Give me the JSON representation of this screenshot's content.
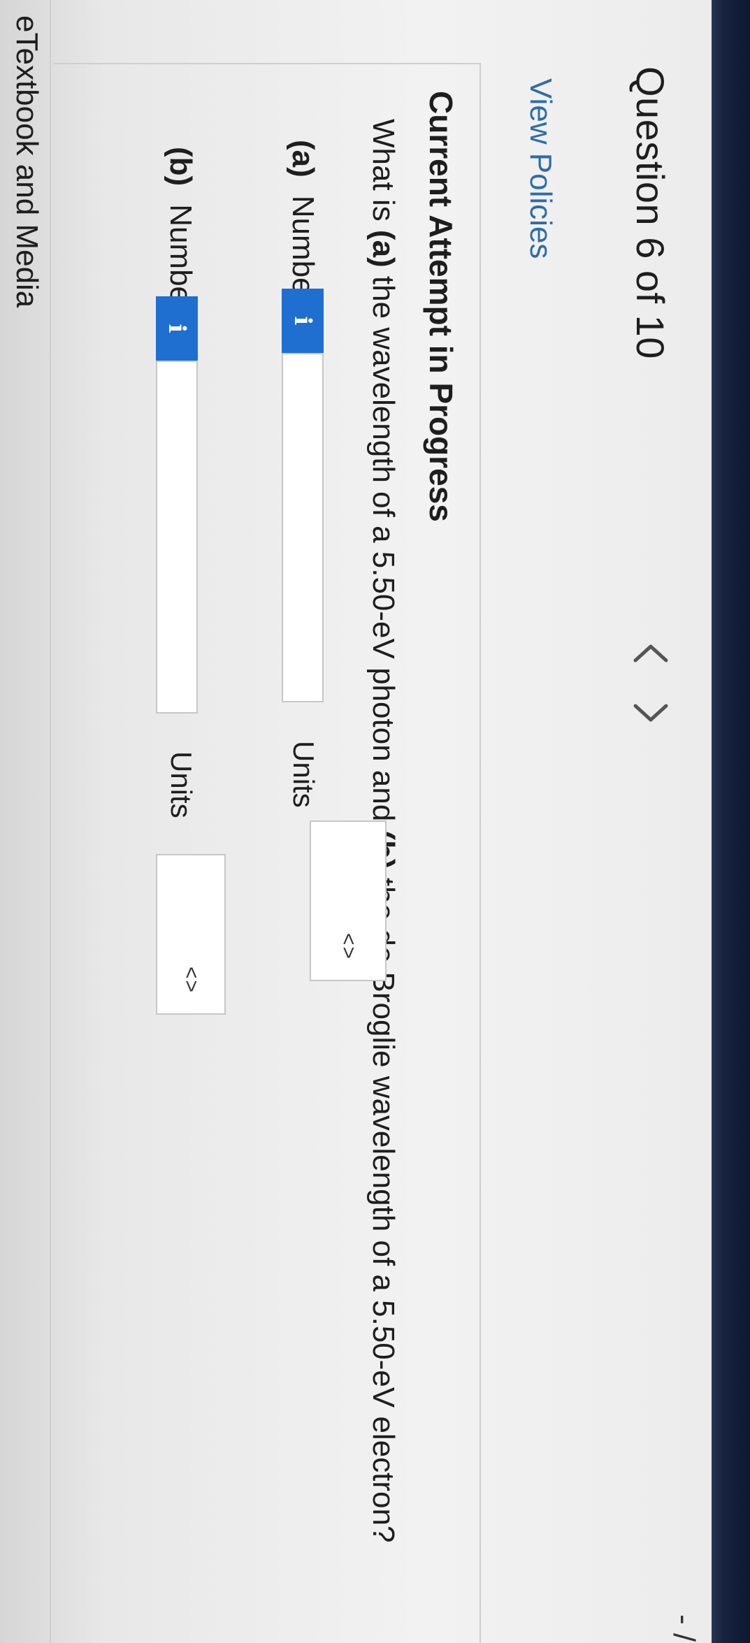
{
  "header": {
    "question_title": "Question 6 of 10",
    "prev_symbol": "‹",
    "next_symbol": "›",
    "corner_mark": "- /"
  },
  "policies": {
    "link_label": "View Policies"
  },
  "attempt": {
    "title": "Current Attempt in Progress",
    "prompt_prefix": "What is ",
    "prompt_a": "(a)",
    "prompt_mid": " the wavelength of a 5.50-eV photon and ",
    "prompt_b": "(b)",
    "prompt_suffix": " the de Broglie wavelength of a 5.50-eV electron?"
  },
  "parts": [
    {
      "tag": "(a)",
      "number_label": "Number",
      "info_glyph": "i",
      "number_value": "",
      "units_label": "Units",
      "units_selected": "",
      "select_arrow": "<>"
    },
    {
      "tag": "(b)",
      "number_label": "Number",
      "info_glyph": "i",
      "number_value": "",
      "units_label": "Units",
      "units_selected": "",
      "select_arrow": "<>"
    }
  ],
  "footer": {
    "etext_label": "eTextbook and Media"
  },
  "colors": {
    "info_button": "#1e6fd0",
    "link": "#2e6da4",
    "dark_strip": "#16233f"
  }
}
